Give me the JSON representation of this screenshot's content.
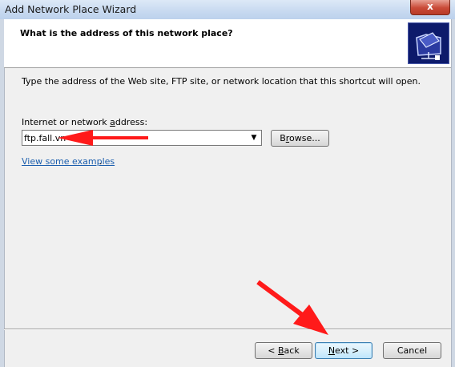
{
  "window": {
    "title": "Add Network Place Wizard",
    "close_glyph": "x"
  },
  "header": {
    "heading": "What is the address of this network place?",
    "icon": "network-folder-icon"
  },
  "body": {
    "instruction": "Type the address of the Web site, FTP site, or network location that this shortcut will open.",
    "address_label_pre": "Internet or network ",
    "address_label_access": "a",
    "address_label_post": "ddress:",
    "address_value": "ftp.fall.vn",
    "examples_link": "View some examples",
    "examples_suffix": "."
  },
  "buttons": {
    "browse_pre": "B",
    "browse_access": "r",
    "browse_post": "owse...",
    "back_pre": "< ",
    "back_access": "B",
    "back_post": "ack",
    "next_access": "N",
    "next_post": "ext >",
    "cancel": "Cancel"
  },
  "colors": {
    "annotation_arrow": "#ff1a1a",
    "link": "#1c5fae",
    "icon_bg": "#0d1a6b"
  }
}
